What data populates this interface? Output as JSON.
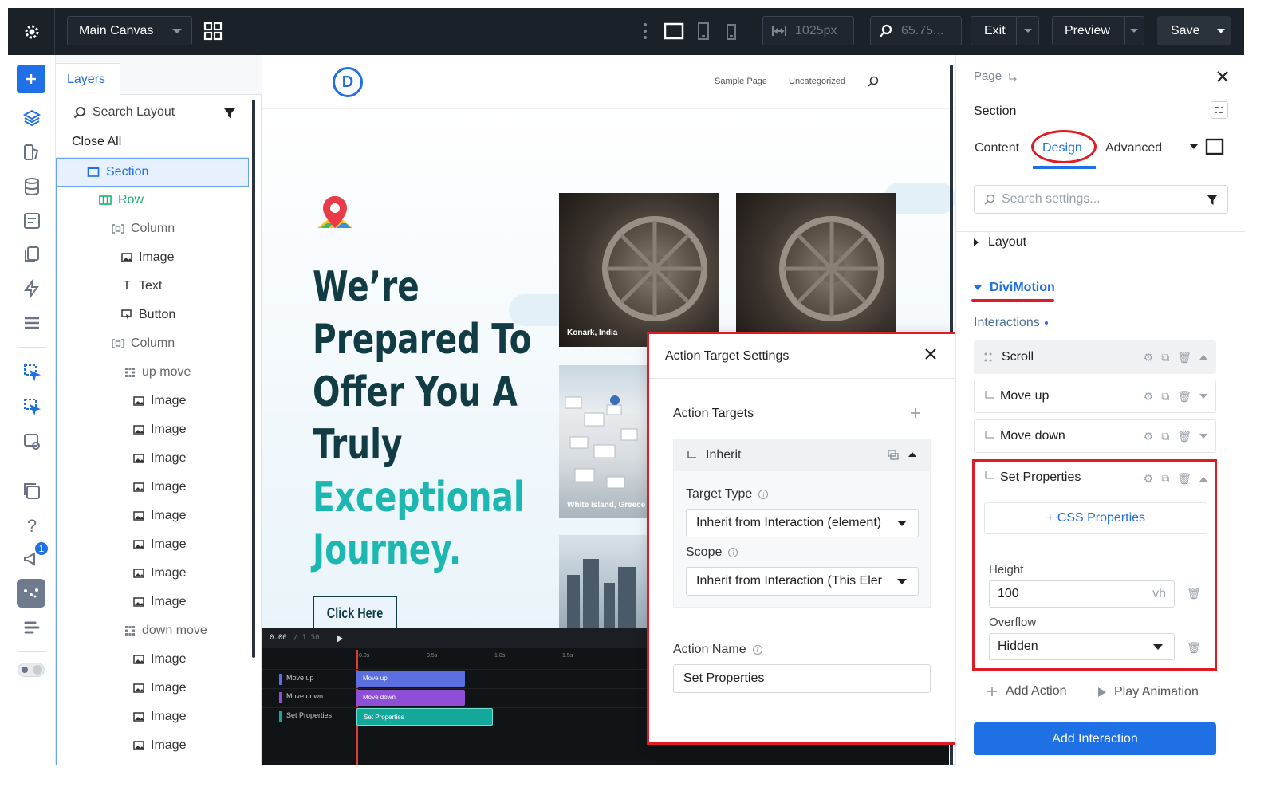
{
  "topbar": {
    "canvas_select": "Main Canvas",
    "width_value": "1025px",
    "zoom_value": "65.75...",
    "exit": "Exit",
    "preview": "Preview",
    "save": "Save"
  },
  "rail": {
    "notification_count": "1"
  },
  "layers": {
    "tab": "Layers",
    "search_placeholder": "Search Layout",
    "close_all": "Close All",
    "items": [
      {
        "label": "Section"
      },
      {
        "label": "Row"
      },
      {
        "label": "Column"
      },
      {
        "label": "Image"
      },
      {
        "label": "Text"
      },
      {
        "label": "Button"
      },
      {
        "label": "Column"
      },
      {
        "label": "up move"
      },
      {
        "label": "Image"
      },
      {
        "label": "Image"
      },
      {
        "label": "Image"
      },
      {
        "label": "Image"
      },
      {
        "label": "Image"
      },
      {
        "label": "Image"
      },
      {
        "label": "Image"
      },
      {
        "label": "Image"
      },
      {
        "label": "down move"
      },
      {
        "label": "Image"
      },
      {
        "label": "Image"
      },
      {
        "label": "Image"
      },
      {
        "label": "Image"
      }
    ]
  },
  "canvas": {
    "logo_letter": "D",
    "nav": [
      "Sample Page",
      "Uncategorized"
    ],
    "headline_1": "We’re",
    "headline_2": "Prepared To",
    "headline_3": "Offer You A",
    "headline_4": "Truly",
    "headline_5": "Exceptional",
    "headline_6": "Journey.",
    "cta": "Click Here",
    "photo_caption_1": "Konark, India",
    "photo_caption_2": "White island, Greece"
  },
  "timeline": {
    "time": "0.00",
    "duration": "/ 1.50",
    "ticks": [
      "0.0s",
      "0.5s",
      "1.0s",
      "1.5s"
    ],
    "tracks": [
      {
        "label": "Move up",
        "bar": "Move up",
        "color": "#5b6fe0"
      },
      {
        "label": "Move down",
        "bar": "Move down",
        "color": "#8e4fd6"
      },
      {
        "label": "Set Properties",
        "bar": "Set Properties",
        "color": "#14a89a"
      }
    ]
  },
  "modal": {
    "title": "Action Target Settings",
    "section_title": "Action Targets",
    "inherit_label": "Inherit",
    "target_type_label": "Target Type",
    "target_type_value": "Inherit from Interaction (element)",
    "scope_label": "Scope",
    "scope_value": "Inherit from Interaction (This Eler",
    "action_name_label": "Action Name",
    "action_name_value": "Set Properties"
  },
  "panel": {
    "breadcrumb": "Page",
    "title": "Section",
    "tabs": [
      "Content",
      "Design",
      "Advanced"
    ],
    "search_placeholder": "Search settings...",
    "layout_group": "Layout",
    "divimotion_group": "DiviMotion",
    "interactions_label": "Interactions",
    "trigger": "Scroll",
    "actions": [
      "Move up",
      "Move down",
      "Set Properties"
    ],
    "css_properties": "+ CSS Properties",
    "height_label": "Height",
    "height_value": "100",
    "height_unit": "vh",
    "overflow_label": "Overflow",
    "overflow_value": "Hidden",
    "add_action": "Add Action",
    "play_animation": "Play Animation",
    "add_interaction": "Add Interaction"
  },
  "colors": {
    "accent_blue": "#1f6fe5",
    "highlight_red": "#e01b24",
    "teal": "#1bb7b0",
    "dark_text": "#123c44"
  }
}
